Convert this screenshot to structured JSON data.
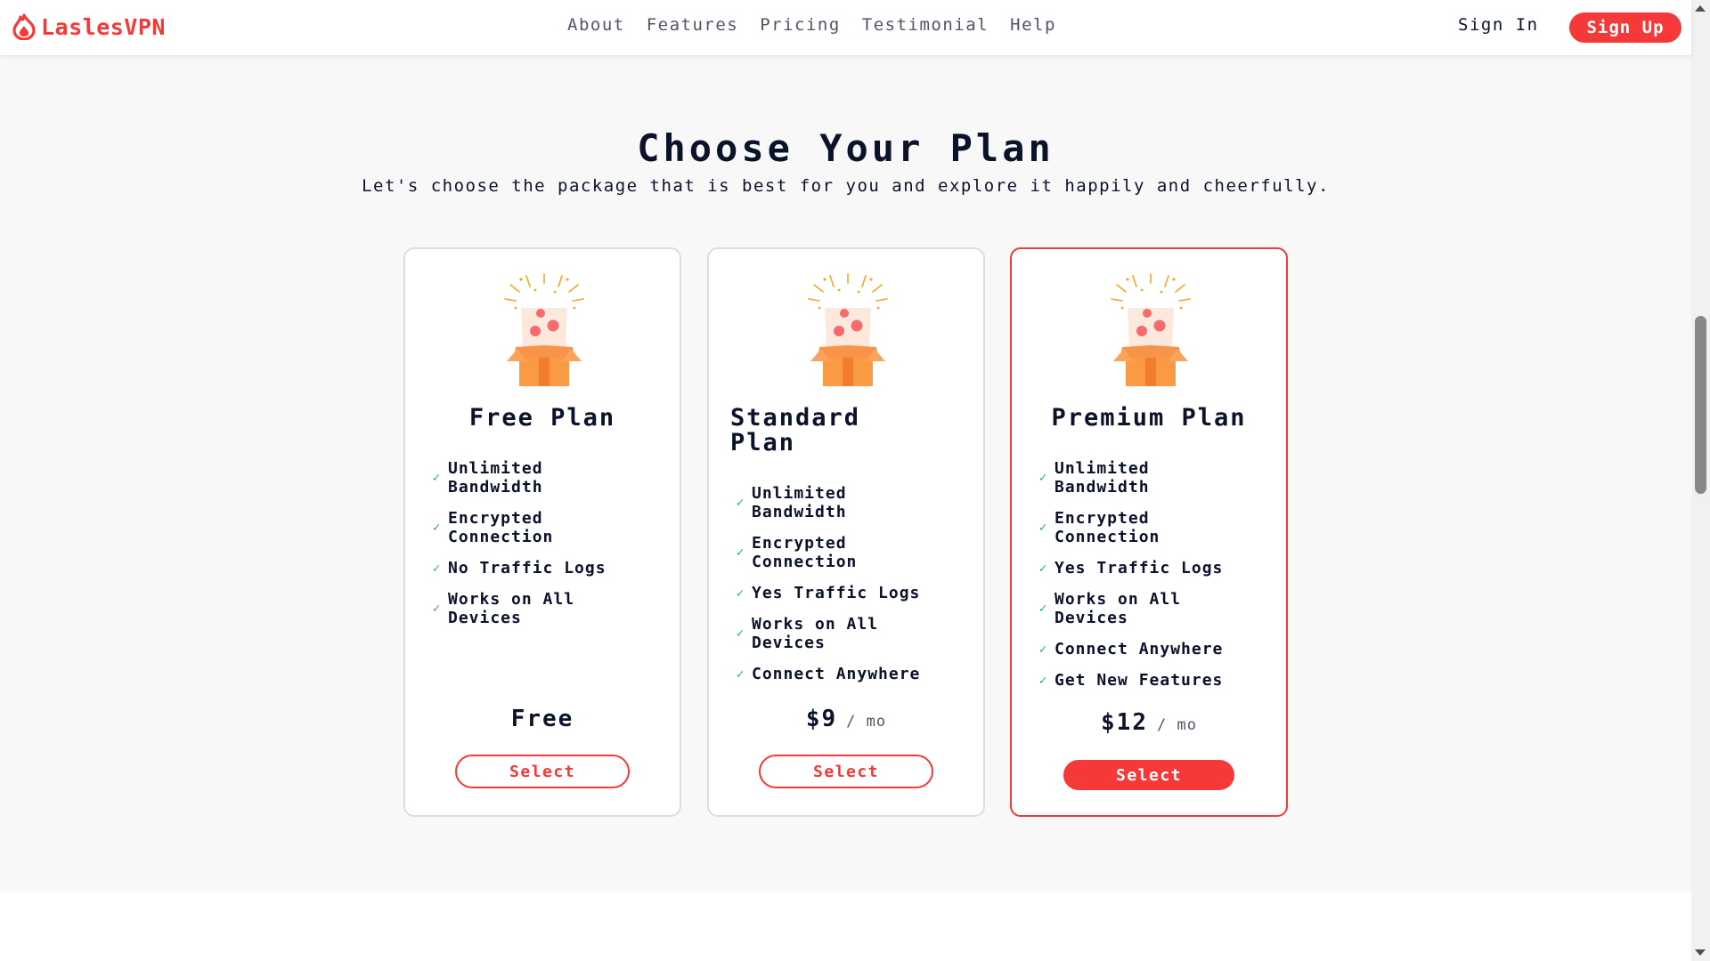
{
  "brand": {
    "name": "LaslesVPN",
    "color": "#f53838"
  },
  "nav": {
    "links": [
      "About",
      "Features",
      "Pricing",
      "Testimonial",
      "Help"
    ],
    "signin": "Sign In",
    "signup": "Sign Up"
  },
  "pricing": {
    "title": "Choose Your Plan",
    "subtitle": "Let's choose the package that is best for you and explore it happily and cheerfully.",
    "plans": [
      {
        "name": "Free Plan",
        "features": [
          "Unlimited Bandwidth",
          "Encrypted Connection",
          "No Traffic Logs",
          "Works on All Devices"
        ],
        "price": "Free",
        "per": "",
        "button": "Select",
        "featured": false
      },
      {
        "name": "Standard Plan",
        "features": [
          "Unlimited Bandwidth",
          "Encrypted Connection",
          "Yes Traffic Logs",
          "Works on All Devices",
          "Connect Anywhere"
        ],
        "price": "$9",
        "per": "/ mo",
        "button": "Select",
        "featured": false
      },
      {
        "name": "Premium Plan",
        "features": [
          "Unlimited Bandwidth",
          "Encrypted Connection",
          "Yes Traffic Logs",
          "Works on All Devices",
          "Connect Anywhere",
          "Get New Features"
        ],
        "price": "$12",
        "per": "/ mo",
        "button": "Select",
        "featured": true
      }
    ]
  },
  "icons": {
    "logo": "flame-logo-icon",
    "plan": "gift-box-icon",
    "feature": "check-icon"
  }
}
